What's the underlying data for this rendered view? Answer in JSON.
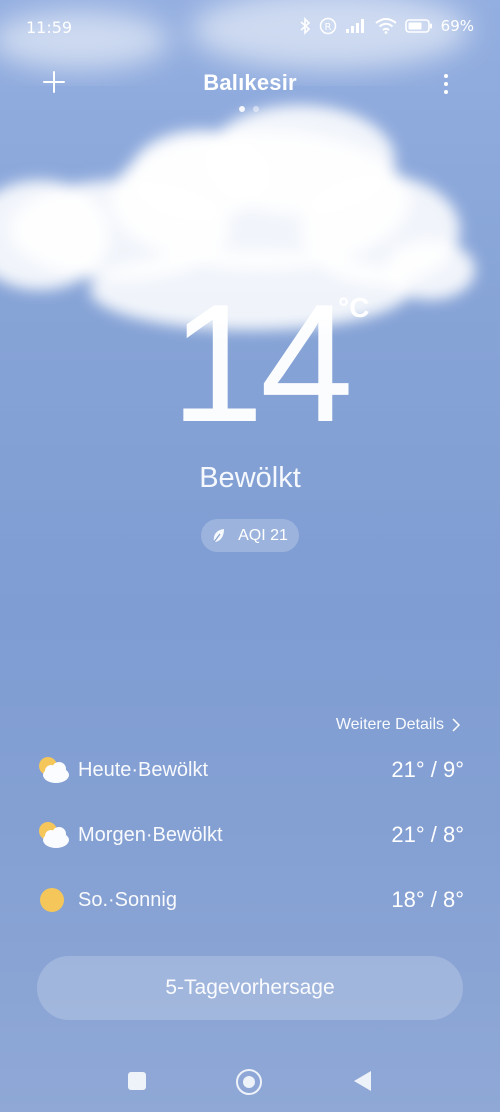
{
  "status_bar": {
    "time": "11:59",
    "battery_percent": "69%",
    "icons": [
      "bluetooth-icon",
      "registered-icon",
      "signal-icon",
      "wifi-icon",
      "battery-icon"
    ]
  },
  "header": {
    "city": "Balıkesir",
    "page_count": 2,
    "active_page": 1
  },
  "current": {
    "temperature": "14",
    "unit": "°C",
    "condition": "Bewölkt",
    "aqi": "AQI 21"
  },
  "details_link": "Weitere Details",
  "forecast": [
    {
      "label": "Heute·Bewölkt",
      "range": "21° / 9°",
      "icon": "partly-cloudy-icon"
    },
    {
      "label": "Morgen·Bewölkt",
      "range": "21° / 8°",
      "icon": "partly-cloudy-icon"
    },
    {
      "label": "So.·Sonnig",
      "range": "18° / 8°",
      "icon": "sun-icon"
    }
  ],
  "forecast_button": "5-Tagevorhersage",
  "colors": {
    "sky_top": "#93aee0",
    "sky_bottom": "#8fa8d6",
    "sun": "#f5c75a"
  }
}
